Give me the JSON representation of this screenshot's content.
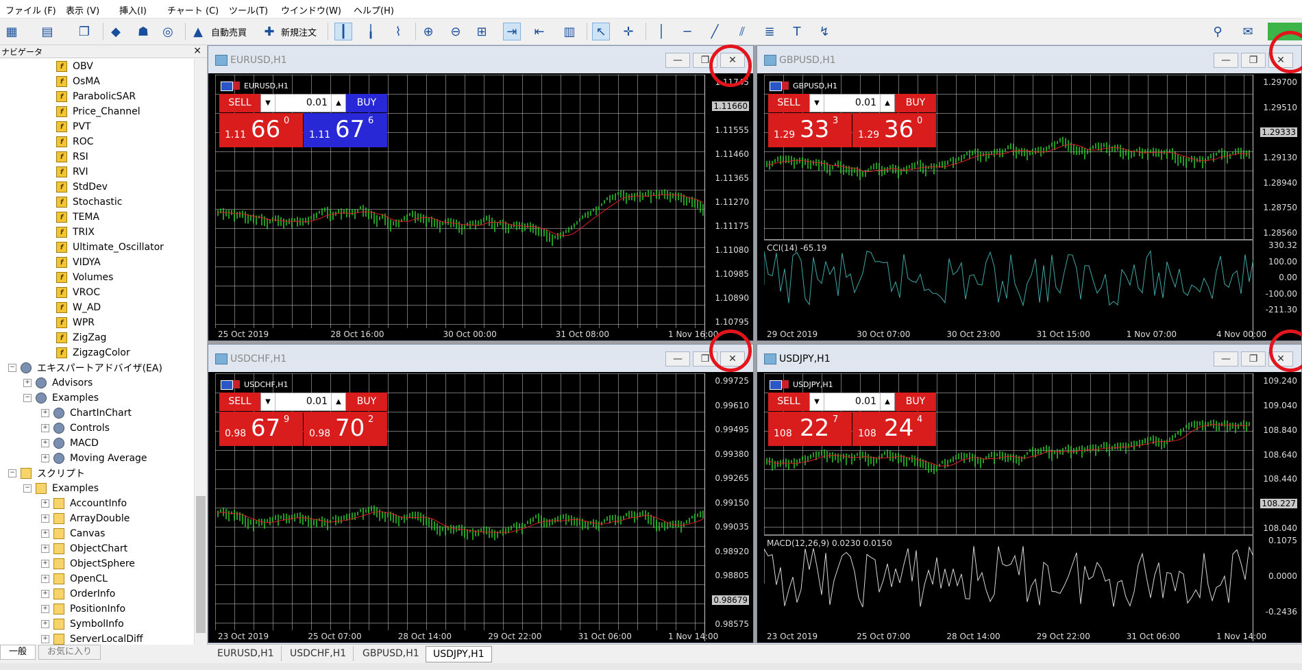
{
  "menu": [
    "ファイル (F)",
    "表示 (V)",
    "挿入(I)",
    "チャート (C)",
    "ツール(T)",
    "ウインドウ(W)",
    "ヘルプ(H)"
  ],
  "toolbar": {
    "auto_trade": "自動売買",
    "new_order": "新規注文"
  },
  "navigator": {
    "title": "ナビゲータ",
    "close": "×",
    "indicators": [
      "OBV",
      "OsMA",
      "ParabolicSAR",
      "Price_Channel",
      "PVT",
      "ROC",
      "RSI",
      "RVI",
      "StdDev",
      "Stochastic",
      "TEMA",
      "TRIX",
      "Ultimate_Oscillator",
      "VIDYA",
      "Volumes",
      "VROC",
      "W_AD",
      "WPR",
      "ZigZag",
      "ZigzagColor"
    ],
    "ea_folder": "エキスパートアドバイザ(EA)",
    "advisors": "Advisors",
    "examples": "Examples",
    "ea_examples": [
      "ChartInChart",
      "Controls",
      "MACD",
      "Moving Average"
    ],
    "scripts_folder": "スクリプト",
    "scripts_examples": "Examples",
    "scripts": [
      "AccountInfo",
      "ArrayDouble",
      "Canvas",
      "ObjectChart",
      "ObjectSphere",
      "OpenCL",
      "OrderInfo",
      "PositionInfo",
      "SymbolInfo",
      "ServerLocalDiff"
    ],
    "tabs": [
      "一般",
      "お気に入り"
    ]
  },
  "charts": [
    {
      "title": "EURUSD,H1",
      "symbol": "EURUSD,H1",
      "sell": "SELL",
      "buy": "BUY",
      "lot": "0.01",
      "sell_small": "1.11",
      "sell_big": "66",
      "sell_sup": "0",
      "buy_small": "1.11",
      "buy_big": "67",
      "buy_sup": "6",
      "buy_color": "blue",
      "prices": [
        "1.11745",
        "1.11660",
        "1.11555",
        "1.11460",
        "1.11365",
        "1.11270",
        "1.11175",
        "1.11080",
        "1.10985",
        "1.10890",
        "1.10795"
      ],
      "current": "1.11660",
      "times": [
        "25 Oct 2019",
        "28 Oct 16:00",
        "30 Oct 00:00",
        "31 Oct 08:00",
        "1 Nov 16:00"
      ]
    },
    {
      "title": "GBPUSD,H1",
      "symbol": "GBPUSD,H1",
      "sell": "SELL",
      "buy": "BUY",
      "lot": "0.01",
      "sell_small": "1.29",
      "sell_big": "33",
      "sell_sup": "3",
      "buy_small": "1.29",
      "buy_big": "36",
      "buy_sup": "0",
      "buy_color": "red",
      "prices": [
        "1.29700",
        "1.29510",
        "1.29333",
        "1.29130",
        "1.28940",
        "1.28750",
        "1.28560"
      ],
      "current": "1.29333",
      "indicator": "CCI(14) -65.19",
      "ind_levels": [
        "330.32",
        "100.00",
        "0.00",
        "-100.00",
        "-211.30"
      ],
      "times": [
        "29 Oct 2019",
        "30 Oct 07:00",
        "30 Oct 23:00",
        "31 Oct 15:00",
        "1 Nov 07:00",
        "4 Nov 00:00"
      ]
    },
    {
      "title": "USDCHF,H1",
      "symbol": "USDCHF,H1",
      "sell": "SELL",
      "buy": "BUY",
      "lot": "0.01",
      "sell_small": "0.98",
      "sell_big": "67",
      "sell_sup": "9",
      "buy_small": "0.98",
      "buy_big": "70",
      "buy_sup": "2",
      "buy_color": "red",
      "prices": [
        "0.99725",
        "0.99610",
        "0.99495",
        "0.99380",
        "0.99265",
        "0.99150",
        "0.99035",
        "0.98920",
        "0.98805",
        "0.98679",
        "0.98575"
      ],
      "current": "0.98679",
      "times": [
        "23 Oct 2019",
        "25 Oct 07:00",
        "28 Oct 14:00",
        "29 Oct 22:00",
        "31 Oct 06:00",
        "1 Nov 14:00"
      ]
    },
    {
      "title": "USDJPY,H1",
      "symbol": "USDJPY,H1",
      "sell": "SELL",
      "buy": "BUY",
      "lot": "0.01",
      "sell_small": "108",
      "sell_big": "22",
      "sell_sup": "7",
      "buy_small": "108",
      "buy_big": "24",
      "buy_sup": "4",
      "buy_color": "red",
      "prices": [
        "109.240",
        "109.040",
        "108.840",
        "108.640",
        "108.440",
        "108.227",
        "108.040"
      ],
      "current": "108.227",
      "indicator": "MACD(12,26,9) 0.0230 0.0150",
      "ind_levels": [
        "0.1075",
        "0.0000",
        "-0.2436"
      ],
      "times": [
        "23 Oct 2019",
        "25 Oct 07:00",
        "28 Oct 14:00",
        "29 Oct 22:00",
        "31 Oct 06:00",
        "1 Nov 14:00"
      ]
    }
  ],
  "chart_tabs": [
    "EURUSD,H1",
    "USDCHF,H1",
    "GBPUSD,H1",
    "USDJPY,H1"
  ],
  "colors": {
    "candle": "#2ecc2e",
    "ma": "#e02020",
    "highlight_ring": "#e3141b"
  }
}
